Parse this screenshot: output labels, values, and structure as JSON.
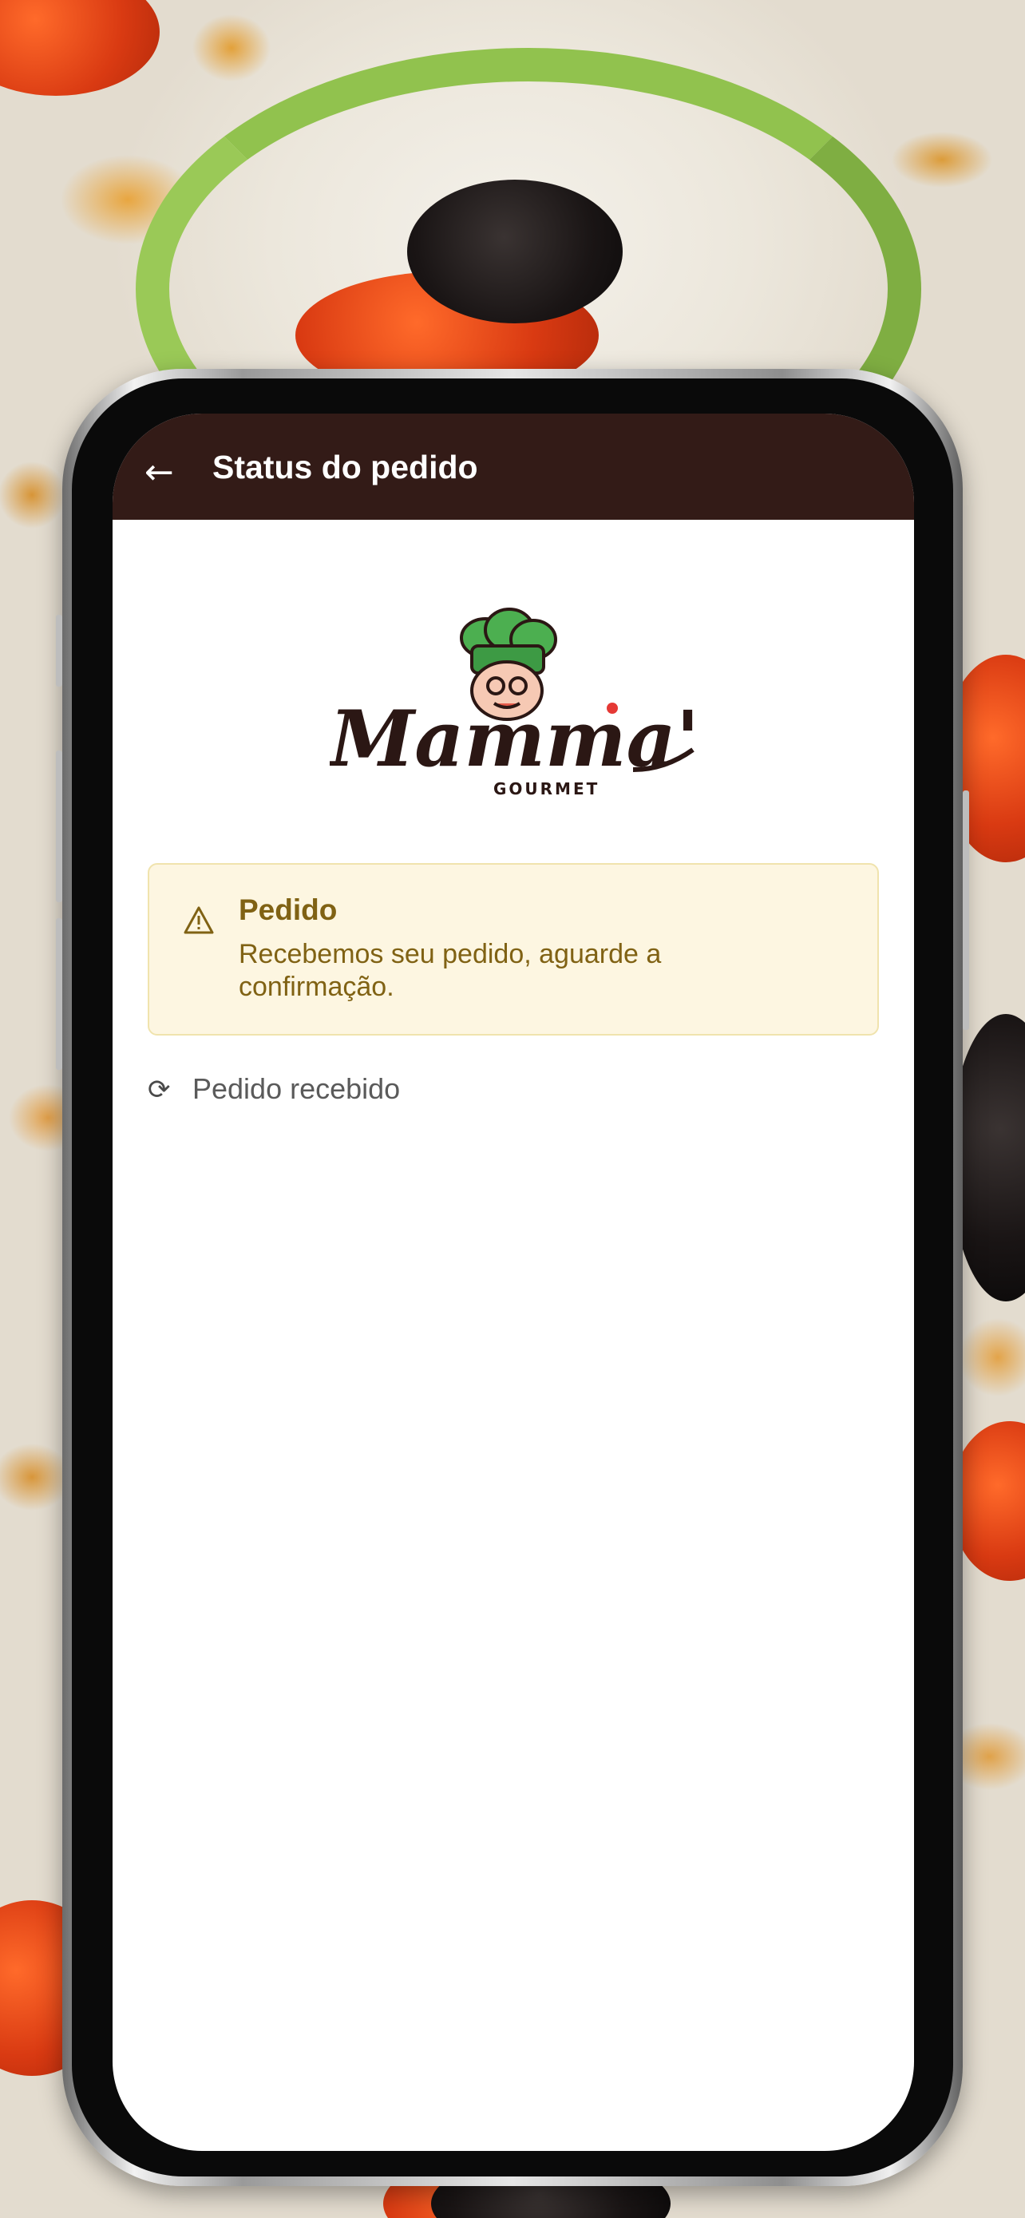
{
  "header": {
    "back_icon": "←",
    "title": "Status do pedido"
  },
  "logo": {
    "brand_name": "Mamma's",
    "brand_sub": "GOURMET"
  },
  "alert": {
    "icon": "warning-icon",
    "title": "Pedido",
    "text": "Recebemos seu pedido, aguarde a confirmação."
  },
  "status": {
    "icon": "⟳",
    "text": "Pedido recebido"
  },
  "colors": {
    "header_bg": "#331b17",
    "alert_bg": "#fdf6e1",
    "alert_text": "#806214",
    "status_text": "#5a5a5a"
  }
}
